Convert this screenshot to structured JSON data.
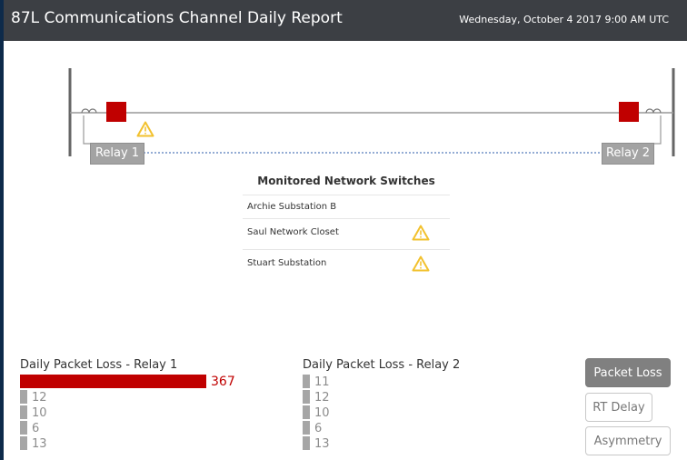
{
  "header": {
    "title": "87L Communications Channel Daily Report",
    "timestamp": "Wednesday, October 4 2017 9:00 AM UTC"
  },
  "diagram": {
    "relay1_label": "Relay 1",
    "relay2_label": "Relay 2",
    "breaker_color": "#c00000",
    "warning_color": "#f2c12e"
  },
  "switches": {
    "title": "Monitored Network Switches",
    "rows": [
      {
        "name": "Archie Substation B",
        "warning": false
      },
      {
        "name": "Saul Network Closet",
        "warning": true
      },
      {
        "name": "Stuart Substation",
        "warning": true
      }
    ]
  },
  "chart_data": [
    {
      "type": "bar",
      "title": "Daily Packet Loss - Relay 1",
      "categories": [
        "",
        "",
        "",
        "",
        ""
      ],
      "values": [
        367,
        12,
        10,
        6,
        13
      ],
      "highlight_color": "#c00000",
      "bar_color": "#a6a6a6"
    },
    {
      "type": "bar",
      "title": "Daily Packet Loss - Relay 2",
      "categories": [
        "",
        "",
        "",
        "",
        ""
      ],
      "values": [
        11,
        12,
        10,
        6,
        13
      ],
      "highlight_color": "#c00000",
      "bar_color": "#a6a6a6"
    }
  ],
  "buttons": {
    "packet_loss": "Packet Loss",
    "rt_delay": "RT Delay",
    "asymmetry": "Asymmetry"
  }
}
